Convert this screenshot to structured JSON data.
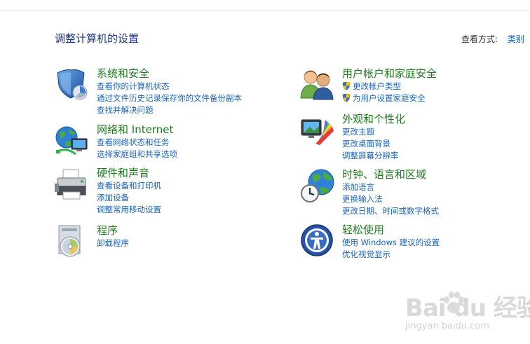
{
  "page": {
    "title": "调整计算机的设置",
    "view_label": "查看方式:",
    "view_value": "类别"
  },
  "categories": [
    {
      "title": "系统和安全",
      "icon": "shield-icon",
      "links": [
        "查看你的计算机状态",
        "通过文件历史记录保存你的文件备份副本",
        "查找并解决问题"
      ]
    },
    {
      "title": "网络和 Internet",
      "icon": "network-globe-icon",
      "links": [
        "查看网络状态和任务",
        "选择家庭组和共享选项"
      ]
    },
    {
      "title": "硬件和声音",
      "icon": "printer-icon",
      "links": [
        "查看设备和打印机",
        "添加设备",
        "调整常用移动设置"
      ]
    },
    {
      "title": "程序",
      "icon": "programs-icon",
      "links": [
        "卸载程序"
      ]
    },
    {
      "title": "用户帐户和家庭安全",
      "icon": "users-icon",
      "links": [
        "更改帐户类型",
        "为用户设置家庭安全"
      ],
      "link_icons": [
        "uac-shield-icon",
        "uac-shield-icon"
      ]
    },
    {
      "title": "外观和个性化",
      "icon": "monitor-palette-icon",
      "links": [
        "更改主题",
        "更改桌面背景",
        "调整屏幕分辨率"
      ]
    },
    {
      "title": "时钟、语言和区域",
      "icon": "clock-globe-icon",
      "links": [
        "添加语言",
        "更换输入法",
        "更改日期、时间或数字格式"
      ]
    },
    {
      "title": "轻松使用",
      "icon": "accessibility-icon",
      "links": [
        "使用 Windows 建议的设置",
        "优化视觉显示"
      ]
    }
  ],
  "watermark": {
    "brand": "Bai du 经验",
    "url": "jingyan.baidu.com"
  },
  "colors": {
    "title_blue": "#1e3287",
    "category_green": "#1c7c1c",
    "link_blue": "#1a64b8"
  }
}
